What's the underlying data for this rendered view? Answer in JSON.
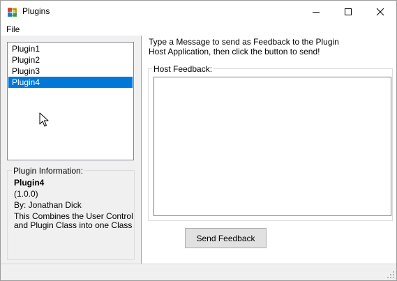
{
  "window": {
    "title": "Plugins",
    "app_icon": "windows-forms-app-icon",
    "controls": {
      "minimize_icon": "minimize-icon",
      "maximize_icon": "maximize-icon",
      "close_icon": "close-icon"
    }
  },
  "menu": {
    "items": [
      {
        "label": "File"
      }
    ]
  },
  "plugins": {
    "items": [
      {
        "label": "Plugin1"
      },
      {
        "label": "Plugin2"
      },
      {
        "label": "Plugin3"
      },
      {
        "label": "Plugin4"
      }
    ],
    "selected_index": 3,
    "selection_color": "#0078d7"
  },
  "plugin_info": {
    "legend": "Plugin Information:",
    "name": "Plugin4",
    "version": "(1.0.0)",
    "author": "By: Jonathan Dick",
    "description_line1": "This Combines the User Control",
    "description_line2": "and Plugin Class into one Class"
  },
  "feedback": {
    "instructions_line1": "Type a Message to send as Feedback to the Plugin",
    "instructions_line2": "Host Application, then click the button to send!",
    "legend": "Host Feedback:",
    "value": "",
    "send_label": "Send Feedback"
  }
}
